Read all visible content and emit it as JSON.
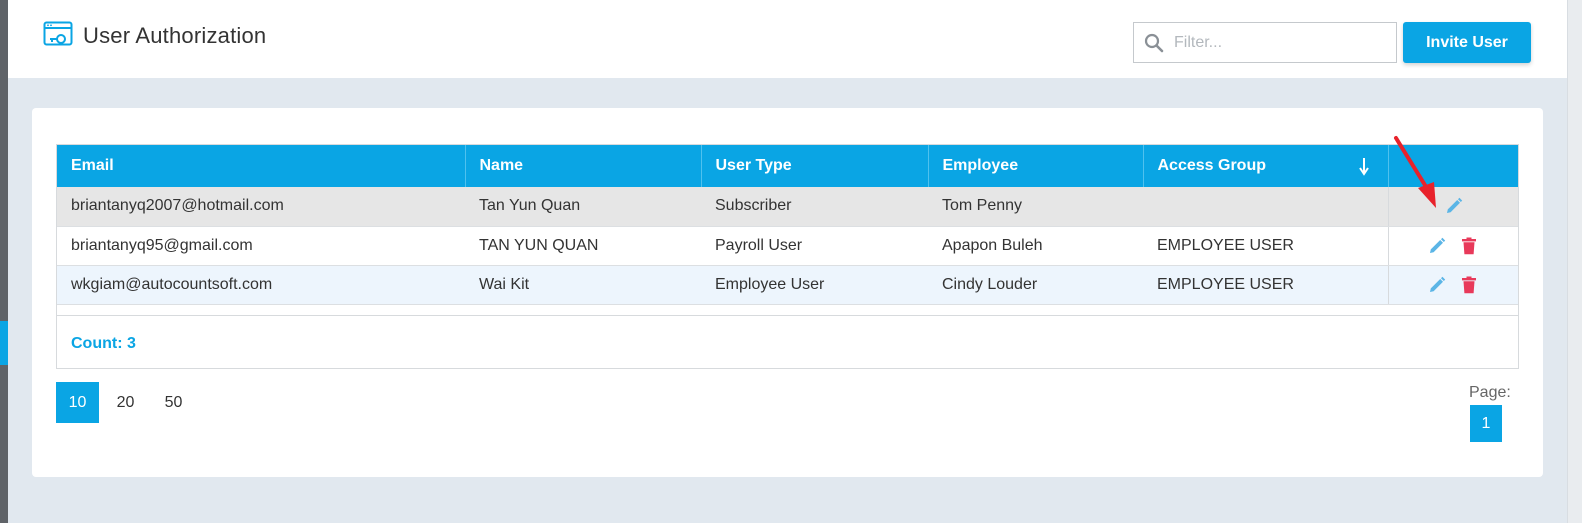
{
  "header": {
    "title": "User Authorization",
    "filter_placeholder": "Filter...",
    "invite_label": "Invite User"
  },
  "table": {
    "columns": [
      "Email",
      "Name",
      "User Type",
      "Employee",
      "Access Group"
    ],
    "sorted_column": "Access Group",
    "sort_direction": "descending",
    "rows": [
      {
        "email": "briantanyq2007@hotmail.com",
        "name": "Tan Yun Quan",
        "user_type": "Subscriber",
        "employee": "Tom Penny",
        "access_group": ""
      },
      {
        "email": "briantanyq95@gmail.com",
        "name": "TAN YUN QUAN",
        "user_type": "Payroll User",
        "employee": "Apapon Buleh",
        "access_group": "EMPLOYEE USER"
      },
      {
        "email": "wkgiam@autocountsoft.com",
        "name": "Wai Kit",
        "user_type": "Employee User",
        "employee": "Cindy Louder",
        "access_group": "EMPLOYEE USER"
      }
    ],
    "count_label": "Count: 3"
  },
  "pager": {
    "sizes": [
      "10",
      "20",
      "50"
    ],
    "active_size": "10",
    "page_label": "Page:",
    "current_page": "1"
  },
  "colors": {
    "accent": "#0aa5e4",
    "delete": "#e8395a",
    "annotation_arrow": "#e8222b"
  },
  "icons": [
    "app-window-icon",
    "search-icon",
    "sort-arrow-down-icon",
    "edit-pencil-icon",
    "trash-icon"
  ]
}
